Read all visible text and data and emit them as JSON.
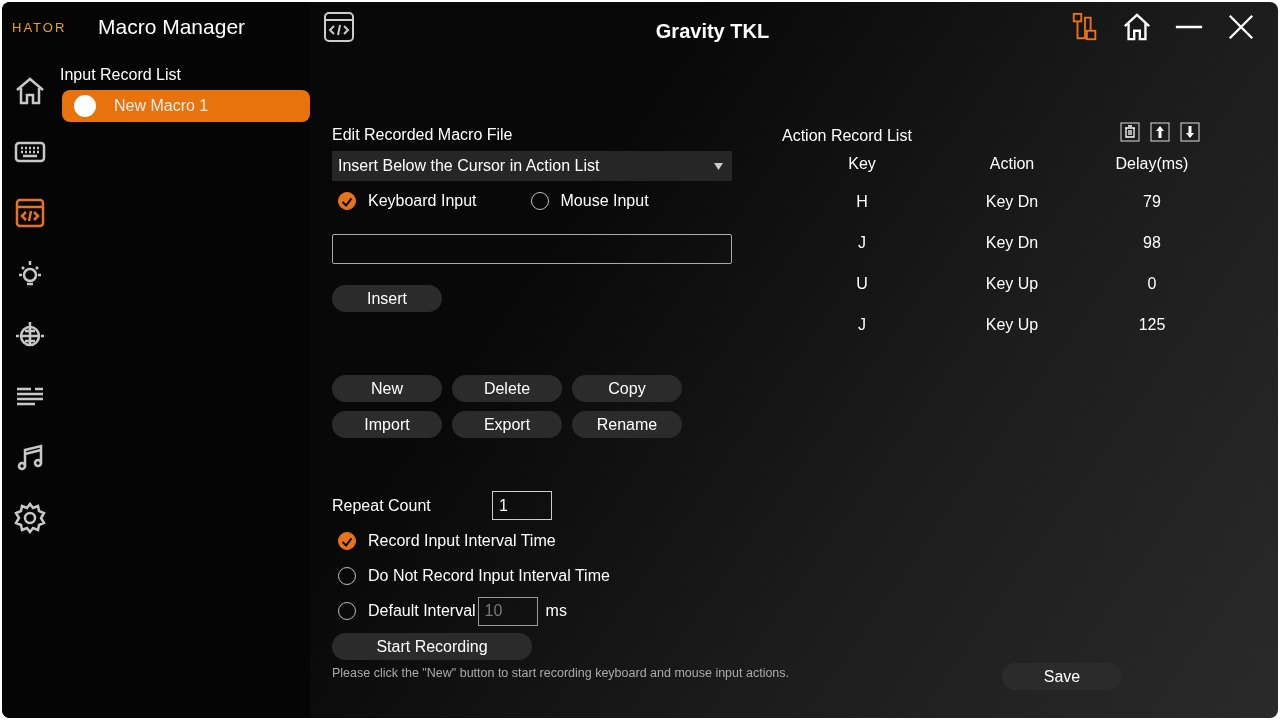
{
  "app": {
    "logo": "HATOR",
    "title": "Macro Manager"
  },
  "device_title": "Gravity TKL",
  "nav": [
    {
      "kind": "home",
      "selected": false
    },
    {
      "kind": "keyboard",
      "selected": false
    },
    {
      "kind": "macro",
      "selected": true
    },
    {
      "kind": "light",
      "selected": false
    },
    {
      "kind": "globe",
      "selected": false
    },
    {
      "kind": "lines",
      "selected": false
    },
    {
      "kind": "music",
      "selected": false
    },
    {
      "kind": "settings",
      "selected": false
    }
  ],
  "record_list": {
    "title": "Input Record List",
    "items": [
      {
        "name": "New Macro 1",
        "selected": true
      }
    ]
  },
  "editor": {
    "title": "Edit Recorded Macro File",
    "insert_mode": "Insert Below the Cursor in Action List",
    "insert_button": "Insert",
    "input_types": [
      {
        "label": "Keyboard Input",
        "selected": true
      },
      {
        "label": "Mouse Input",
        "selected": false
      }
    ]
  },
  "file_buttons": [
    "New",
    "Delete",
    "Copy",
    "Import",
    "Export",
    "Rename"
  ],
  "repeat": {
    "label": "Repeat Count",
    "value": "1"
  },
  "interval_options": [
    {
      "label": "Record Input Interval Time",
      "selected": true
    },
    {
      "label": "Do Not Record Input Interval Time",
      "selected": false
    },
    {
      "label": "Default Interval",
      "selected": false,
      "value": "10",
      "unit": "ms"
    }
  ],
  "start_button": "Start Recording",
  "hint": "Please click the \"New\" button to start recording keyboard and mouse input actions.",
  "action_list": {
    "title": "Action Record List",
    "columns": [
      "Key",
      "Action",
      "Delay(ms)"
    ],
    "rows": [
      [
        "H",
        "Key Dn",
        "79"
      ],
      [
        "J",
        "Key Dn",
        "98"
      ],
      [
        "U",
        "Key Up",
        "0"
      ],
      [
        "J",
        "Key Up",
        "125"
      ]
    ]
  },
  "save_button": "Save"
}
